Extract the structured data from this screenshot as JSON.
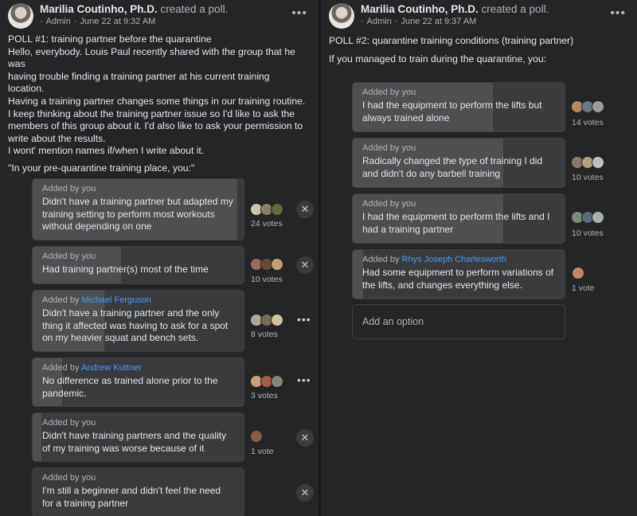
{
  "post1": {
    "author": "Marilia Coutinho, Ph.D.",
    "action": "created a poll.",
    "role": "Admin",
    "sep": "·",
    "date": "June 22 at 9:32 AM",
    "menu": "•••",
    "lines": [
      "POLL #1: training partner before the quarantine",
      "Hello, everybody. Louis Paul recently shared with the group that he was",
      "having trouble finding a training partner at his current training",
      "location.",
      "Having a training partner changes some things in our training routine.",
      "I keep thinking about the training partner issue so I'd like to ask the",
      "members of this group about it. I'd also like to ask your permission to",
      "write about the results.",
      "I wont' mention names if/when I write about it."
    ],
    "question": "\"In your pre-quarantine training place, you:\"",
    "options": [
      {
        "added_prefix": "Added by",
        "added_by": "you",
        "label": "Didn't have a training partner but adapted my training setting to perform most workouts without depending on one",
        "votes": "24 votes",
        "fill": 0.97,
        "action": "✕",
        "voters": [
          "#c7c4b0",
          "#8a7f6a",
          "#5f6b3e"
        ]
      },
      {
        "added_prefix": "Added by",
        "added_by": "you",
        "label": "Had training partner(s) most of the time",
        "votes": "10 votes",
        "fill": 0.42,
        "action": "✕",
        "voters": [
          "#9a6a5a",
          "#6b4a3a",
          "#c9a070"
        ]
      },
      {
        "added_prefix": "Added by",
        "added_by": "Michael Ferguson",
        "label": "Didn't have a training partner and the only thing it affected was having to ask for a spot on my heavier squat and bench sets.",
        "votes": "8 votes",
        "fill": 0.34,
        "action": "•••",
        "voters": [
          "#b0a896",
          "#7a6a5a",
          "#d0c0a0"
        ]
      },
      {
        "added_prefix": "Added by",
        "added_by": "Andrew Kuttner",
        "label": "No difference as trained alone prior to the pandemic.",
        "votes": "3 votes",
        "fill": 0.14,
        "action": "•••",
        "voters": [
          "#c8a078",
          "#a06040",
          "#808878"
        ]
      },
      {
        "added_prefix": "Added by",
        "added_by": "you",
        "label": "Didn't have training partners and the quality of my training was worse because of it",
        "votes": "1 vote",
        "fill": 0.04,
        "action": "✕",
        "voters": [
          "#8a5a4a"
        ]
      },
      {
        "added_prefix": "Added by",
        "added_by": "you",
        "label": "I'm still a beginner and didn't feel the need for a training partner",
        "votes": "",
        "fill": 0.0,
        "action": "✕",
        "voters": []
      }
    ]
  },
  "post2": {
    "author": "Marilia Coutinho, Ph.D.",
    "action": "created a poll.",
    "role": "Admin",
    "sep": "·",
    "date": "June 22 at 9:37 AM",
    "menu": "•••",
    "lines": [
      "POLL #2: quarantine training conditions (training partner)",
      "If you managed to train during the quarantine, you:"
    ],
    "options": [
      {
        "added_prefix": "Added by",
        "added_by": "you",
        "label": "I had the equipment to perform the lifts but always trained alone",
        "votes": "14 votes",
        "fill": 0.66,
        "voters": [
          "#b08a60",
          "#6a7a8a",
          "#9a9a9a"
        ]
      },
      {
        "added_prefix": "Added by",
        "added_by": "you",
        "label": "Radically changed the type of training I did and didn't do any barbell training",
        "votes": "10 votes",
        "fill": 0.71,
        "voters": [
          "#8a7a6a",
          "#b0a080",
          "#c0c0c0"
        ]
      },
      {
        "added_prefix": "Added by",
        "added_by": "you",
        "label": "I had the equipment to perform the lifts and I had a training partner",
        "votes": "10 votes",
        "fill": 0.71,
        "voters": [
          "#7a8a7a",
          "#5a6a7a",
          "#aab0b0"
        ]
      },
      {
        "added_prefix": "Added by",
        "added_by": "Rhys Joseph Charlesworth",
        "label": "Had some equipment to perform variations of the lifts, and changes everything else.",
        "votes": "1 vote",
        "fill": 0.05,
        "voters": [
          "#c08868"
        ]
      }
    ],
    "add_option": "Add an option"
  }
}
